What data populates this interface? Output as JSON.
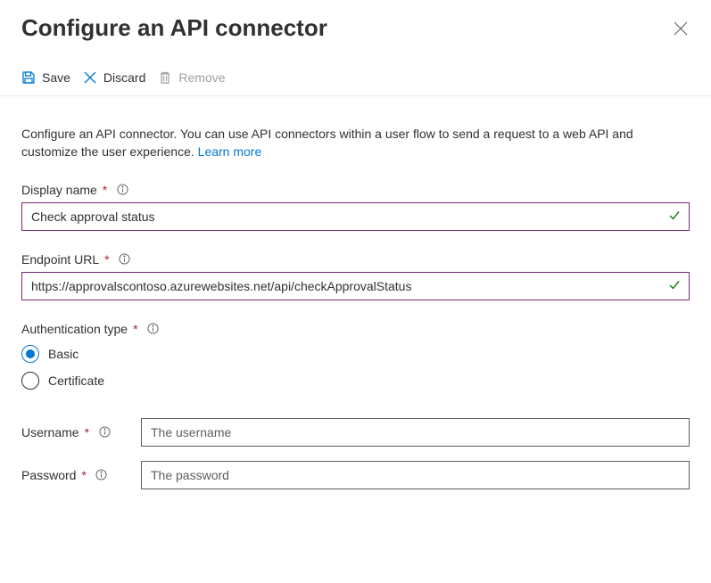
{
  "header": {
    "title": "Configure an API connector"
  },
  "toolbar": {
    "save_label": "Save",
    "discard_label": "Discard",
    "remove_label": "Remove"
  },
  "description": {
    "text": "Configure an API connector. You can use API connectors within a user flow to send a request to a web API and customize the user experience. ",
    "link_text": "Learn more"
  },
  "fields": {
    "display_name": {
      "label": "Display name",
      "value": "Check approval status"
    },
    "endpoint_url": {
      "label": "Endpoint URL",
      "value": "https://approvalscontoso.azurewebsites.net/api/checkApprovalStatus"
    },
    "auth_type": {
      "label": "Authentication type",
      "options": {
        "basic": "Basic",
        "certificate": "Certificate"
      },
      "selected": "basic"
    },
    "username": {
      "label": "Username",
      "placeholder": "The username",
      "value": ""
    },
    "password": {
      "label": "Password",
      "placeholder": "The password",
      "value": ""
    }
  }
}
